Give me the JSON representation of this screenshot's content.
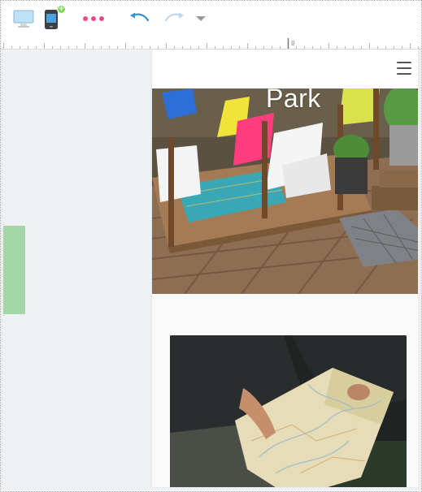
{
  "toolbar": {
    "buttons": [
      {
        "name": "desktop-view",
        "icon": "desktop-icon"
      },
      {
        "name": "mobile-view",
        "icon": "mobile-icon",
        "badge": "+"
      },
      {
        "name": "more-options",
        "icon": "more-dots-icon"
      },
      {
        "name": "undo",
        "icon": "undo-icon"
      },
      {
        "name": "redo",
        "icon": "redo-icon"
      },
      {
        "name": "history-dropdown",
        "icon": "caret-down-icon"
      }
    ]
  },
  "ruler": {
    "origin_label": "0"
  },
  "preview": {
    "hero_title": "Park",
    "menu_icon": "hamburger-icon",
    "hero_image": "outdoor-deck-chairs-image",
    "card_image": "people-reading-map-image"
  },
  "colors": {
    "accent_blue": "#4aa3df",
    "dots_pink": "#e84c8a",
    "badge_green": "#7ed957",
    "handle_green": "#a5d6a7",
    "canvas_bg": "#eff2f5"
  }
}
